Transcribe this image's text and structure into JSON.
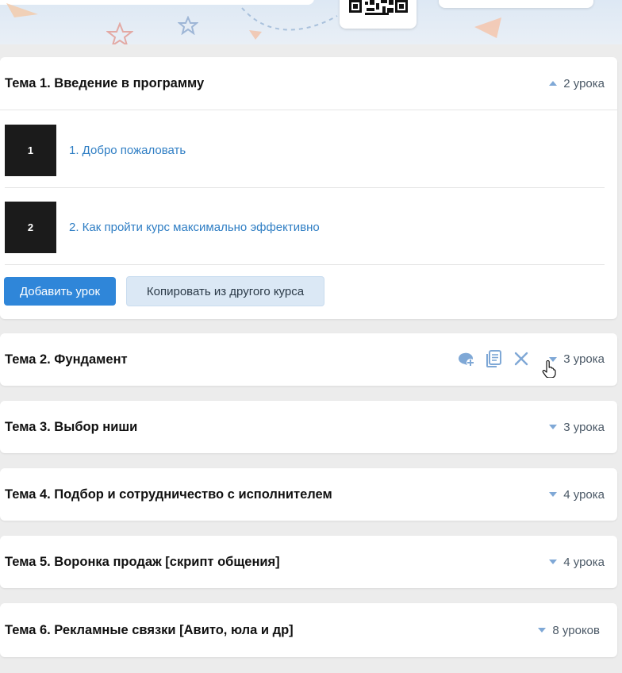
{
  "colors": {
    "accent": "#2f86d9",
    "link": "#2f7ec4",
    "caret": "#7fa8d6",
    "page_bg": "#ececec",
    "card_bg": "#ffffff"
  },
  "topics": [
    {
      "title": "Тема 1. Введение в программу",
      "count": "2 урока",
      "expanded": true,
      "lessons": [
        {
          "thumb": "1",
          "label": "1. Добро пожаловать"
        },
        {
          "thumb": "2",
          "label": "2. Как пройти курс максимально эффективно"
        }
      ],
      "add_lesson_label": "Добавить урок",
      "copy_label": "Копировать из другого курса"
    },
    {
      "title": "Тема 2. Фундамент",
      "count": "3 урока",
      "expanded": false,
      "icons": [
        "add-comment-icon",
        "copy-document-icon",
        "close-icon"
      ]
    },
    {
      "title": "Тема 3. Выбор ниши",
      "count": "3 урока",
      "expanded": false
    },
    {
      "title": "Тема 4. Подбор и сотрудничество с исполнителем",
      "count": "4 урока",
      "expanded": false
    },
    {
      "title": "Тема 5. Воронка продаж [скрипт общения]",
      "count": "4 урока",
      "expanded": false
    },
    {
      "title": "Тема 6. Рекламные связки [Авито, юла и др]",
      "count": "8 уроков",
      "expanded": false
    }
  ]
}
